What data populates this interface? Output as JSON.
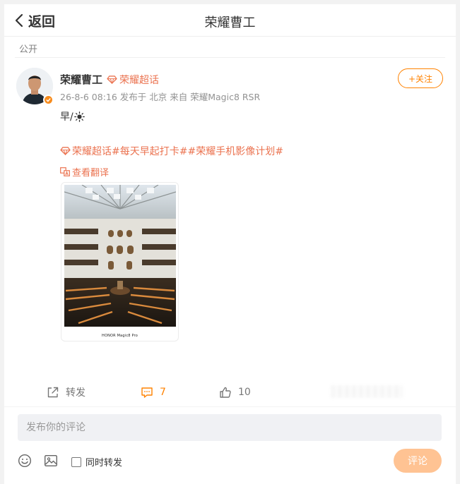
{
  "header": {
    "back_label": "返回",
    "title": "荣耀曹工"
  },
  "post": {
    "visibility": "公开",
    "author": "荣耀曹工",
    "super_topic_tag": "荣耀超话",
    "meta": "26-8-6 08:16  发布于 北京  来自 荣耀Magic8 RSR",
    "follow_label": "+关注",
    "text": "早/",
    "text_icon": "sun-icon",
    "topics": {
      "super_topic": "荣耀超话",
      "tag1": "#每天早起打卡#",
      "tag2": "#荣耀手机影像计划#"
    },
    "translate_label": "查看翻译",
    "photo_watermark": "HONOR Magic8 Pro"
  },
  "actions": {
    "repost_label": "转发",
    "comment_count": "7",
    "like_count": "10"
  },
  "comment_box": {
    "placeholder": "发布你的评论",
    "repost_checkbox_label": "同时转发",
    "repost_checked": false,
    "submit_label": "评论"
  },
  "colors": {
    "accent": "#ff8200",
    "topic": "#eb7350",
    "submit_disabled": "#ffc393"
  }
}
